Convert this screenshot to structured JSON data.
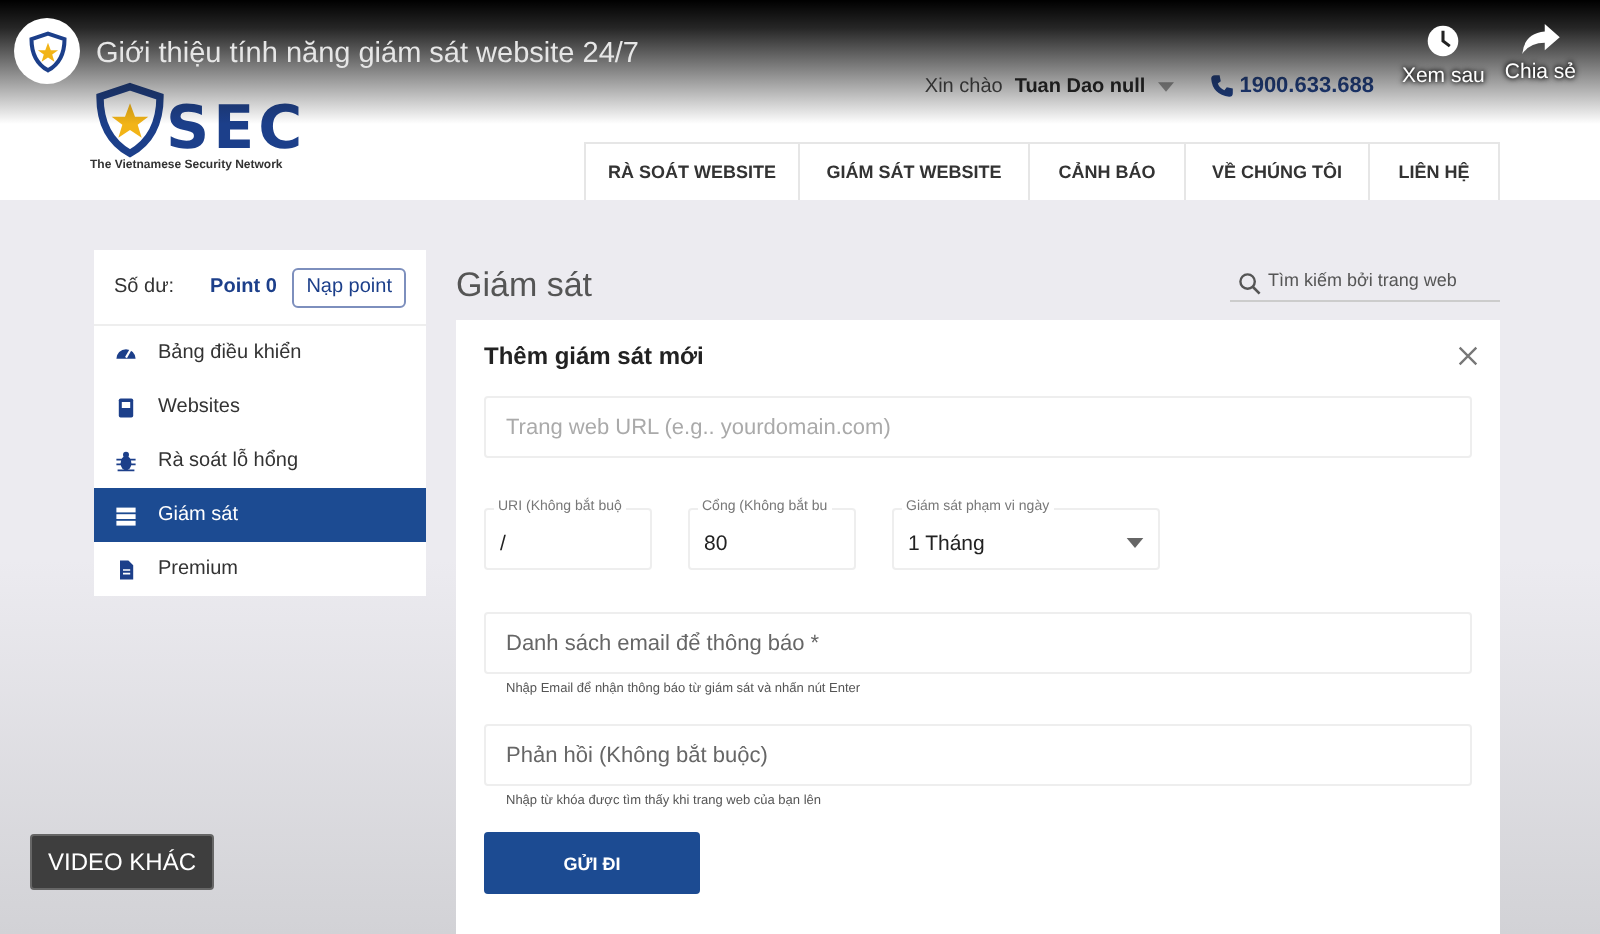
{
  "video": {
    "title": "Giới thiệu tính năng giám sát website 24/7",
    "actions": [
      {
        "kind": "watch_later",
        "label": "Xem sau"
      },
      {
        "kind": "share",
        "label": "Chia sẻ"
      }
    ],
    "more_videos": "VIDEO KHÁC"
  },
  "site": {
    "logo": {
      "wordmark": "SEC",
      "tagline": "The Vietnamese Security Network"
    },
    "greeting": "Xin chào",
    "user": "Tuan Dao null",
    "phone": "1900.633.688",
    "nav": [
      {
        "label": "RÀ SOÁT WEBSITE",
        "selected": false
      },
      {
        "label": "GIÁM SÁT WEBSITE",
        "selected": false
      },
      {
        "label": "CẢNH BÁO",
        "selected": false
      },
      {
        "label": "VỀ CHÚNG TÔI",
        "selected": false
      },
      {
        "label": "LIÊN HỆ",
        "selected": false
      }
    ]
  },
  "sidebar": {
    "balance_label": "Số dư:",
    "balance": "Point 0",
    "topup": "Nạp point",
    "items": [
      {
        "label": "Bảng điều khiển",
        "selected": false
      },
      {
        "label": "Websites",
        "selected": false
      },
      {
        "label": "Rà soát lỗ hổng",
        "selected": false
      },
      {
        "label": "Giám sát",
        "selected": true
      },
      {
        "label": "Premium",
        "selected": false
      }
    ]
  },
  "main": {
    "title": "Giám sát",
    "search": {
      "placeholder": "Tìm kiếm bởi trang web"
    },
    "form": {
      "title": "Thêm giám sát mới",
      "url_field": {
        "placeholder": "Trang web URL (e.g.. yourdomain.com)"
      },
      "options": [
        {
          "kind": "text",
          "label": "URI (Không bắt buộ",
          "value": "/"
        },
        {
          "kind": "text",
          "label": "Cổng (Không bắt bu",
          "value": "80"
        },
        {
          "kind": "select",
          "label": "Giám sát phạm vi ngày",
          "value": "1 Tháng"
        }
      ],
      "email_field": {
        "placeholder": "Danh sách email để thông báo *",
        "help": "Nhập Email để nhận thông báo từ giám sát và nhấn nút Enter"
      },
      "feedback_field": {
        "placeholder": "Phản hồi (Không bắt buộc)",
        "help": "Nhập từ khóa được tìm thấy khi trang web của bạn lên"
      },
      "submit": "GỬI ĐI"
    }
  }
}
